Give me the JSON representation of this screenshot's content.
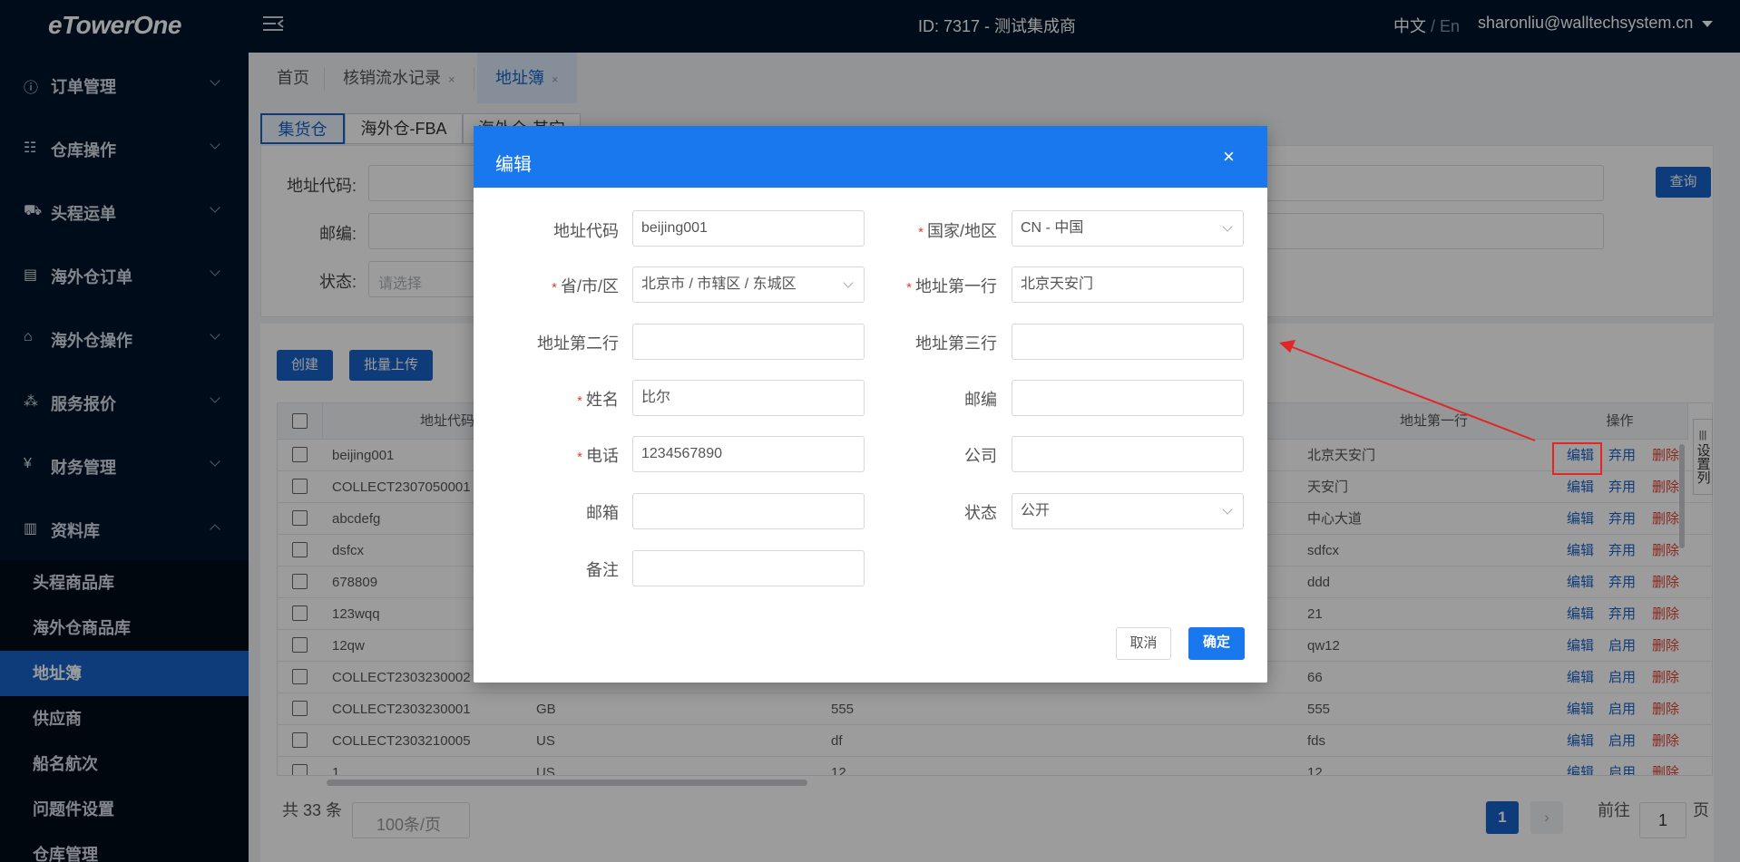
{
  "topbar": {
    "logo": "eTowerOne",
    "title": "ID: 7317 - 测试集成商",
    "lang_zh": "中文",
    "lang_sep": " / ",
    "lang_en": "En",
    "user": "sharonliu@walltechsystem.cn"
  },
  "sidebar": {
    "menu": [
      {
        "label": "订单管理",
        "icon": "ⓘ"
      },
      {
        "label": "仓库操作",
        "icon": "☷"
      },
      {
        "label": "头程运单",
        "icon": "⛟"
      },
      {
        "label": "海外仓订单",
        "icon": "▤"
      },
      {
        "label": "海外仓操作",
        "icon": "⌂"
      },
      {
        "label": "服务报价",
        "icon": "⁂"
      },
      {
        "label": "财务管理",
        "icon": "¥"
      },
      {
        "label": "资料库",
        "icon": "▥"
      }
    ],
    "sub": [
      "头程商品库",
      "海外仓商品库",
      "地址簿",
      "供应商",
      "船名航次",
      "问题件设置",
      "仓库管理"
    ]
  },
  "tabs": [
    {
      "label": "首页"
    },
    {
      "label": "核销流水记录",
      "close": "×"
    },
    {
      "label": "地址簿",
      "close": "×"
    }
  ],
  "subtabs": [
    "集货仓",
    "海外仓-FBA",
    "海外仓-其它"
  ],
  "filter": {
    "addr_code_label": "地址代码:",
    "postcode_label": "邮编:",
    "status_label": "状态:",
    "status_placeholder": "请选择",
    "query": "查询"
  },
  "toolbar": {
    "create": "创建",
    "bulk_upload": "批量上传"
  },
  "grid": {
    "headers": {
      "code": "地址代码",
      "addr1": "地址第一行",
      "ops": "操作"
    },
    "rows": [
      {
        "code": "beijing001",
        "c2": "",
        "c4": "",
        "addr1": "北京天安门",
        "toggle": "弃用"
      },
      {
        "code": "COLLECT2307050001",
        "c2": "",
        "c4": "",
        "addr1": "天安门",
        "toggle": "弃用"
      },
      {
        "code": "abcdefg",
        "c2": "",
        "c4": "",
        "addr1": "中心大道",
        "toggle": "弃用"
      },
      {
        "code": "dsfcx",
        "c2": "",
        "c4": "",
        "addr1": "sdfcx",
        "toggle": "弃用"
      },
      {
        "code": "678809",
        "c2": "",
        "c4": "",
        "addr1": "ddd",
        "toggle": "弃用"
      },
      {
        "code": "123wqq",
        "c2": "",
        "c4": "",
        "addr1": "21",
        "toggle": "弃用"
      },
      {
        "code": "12qw",
        "c2": "",
        "c4": "",
        "addr1": "qw12",
        "toggle": "启用"
      },
      {
        "code": "COLLECT2303230002",
        "c2": "",
        "c4": "",
        "addr1": "66",
        "toggle": "启用"
      },
      {
        "code": "COLLECT2303230001",
        "c2": "GB",
        "c4": "555",
        "addr1": "555",
        "toggle": "启用"
      },
      {
        "code": "COLLECT2303210005",
        "c2": "US",
        "c4": "df",
        "addr1": "fds",
        "toggle": "启用"
      },
      {
        "code": "1",
        "c2": "US",
        "c4": "12",
        "addr1": "12",
        "toggle": "启用"
      }
    ],
    "edit": "编辑",
    "delete": "删除",
    "column_settings": "设置列"
  },
  "footer": {
    "total": "共 33 条",
    "page_size": "100条/页",
    "current_page": "1",
    "goto_label": "前往",
    "goto_value": "1",
    "goto_suffix": "页",
    "prev": "‹",
    "next": "›"
  },
  "modal": {
    "title": "编辑",
    "close": "×",
    "fields": {
      "addr_code": {
        "label": "地址代码",
        "value": "beijing001"
      },
      "country": {
        "label": "国家/地区",
        "value": "CN - 中国",
        "required": "*"
      },
      "province": {
        "label": "省/市/区",
        "value": "北京市 / 市辖区 / 东城区",
        "required": "*"
      },
      "addr1": {
        "label": "地址第一行",
        "value": "北京天安门",
        "required": "*"
      },
      "addr2": {
        "label": "地址第二行",
        "value": ""
      },
      "addr3": {
        "label": "地址第三行",
        "value": ""
      },
      "name": {
        "label": "姓名",
        "value": "比尔",
        "required": "*"
      },
      "postcode": {
        "label": "邮编",
        "value": ""
      },
      "phone": {
        "label": "电话",
        "value": "1234567890",
        "required": "*"
      },
      "company": {
        "label": "公司",
        "value": ""
      },
      "email": {
        "label": "邮箱",
        "value": ""
      },
      "status": {
        "label": "状态",
        "value": "公开"
      },
      "remark": {
        "label": "备注",
        "value": ""
      }
    },
    "cancel": "取消",
    "confirm": "确定"
  },
  "annotation": {
    "color": "#e32525"
  }
}
